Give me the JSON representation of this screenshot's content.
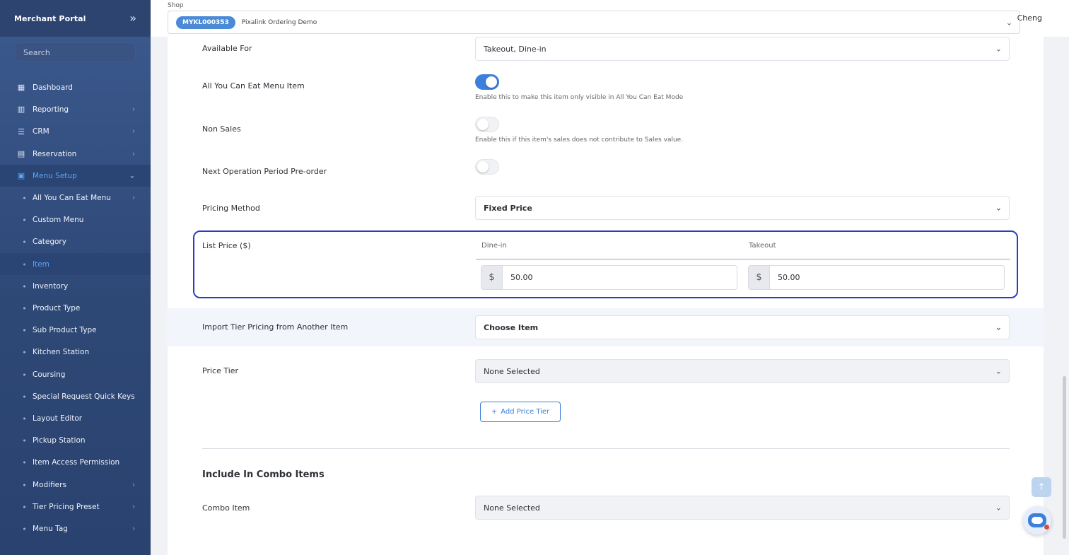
{
  "sidebar": {
    "brand": "Merchant Portal",
    "search_placeholder": "Search",
    "items": [
      {
        "label": "Dashboard"
      },
      {
        "label": "Reporting"
      },
      {
        "label": "CRM"
      },
      {
        "label": "Reservation"
      },
      {
        "label": "Menu Setup"
      }
    ],
    "sub_items": [
      {
        "label": "All You Can Eat Menu"
      },
      {
        "label": "Custom Menu"
      },
      {
        "label": "Category"
      },
      {
        "label": "Item"
      },
      {
        "label": "Inventory"
      },
      {
        "label": "Product Type"
      },
      {
        "label": "Sub Product Type"
      },
      {
        "label": "Kitchen Station"
      },
      {
        "label": "Coursing"
      },
      {
        "label": "Special Request Quick Keys"
      },
      {
        "label": "Layout Editor"
      },
      {
        "label": "Pickup Station"
      },
      {
        "label": "Item Access Permission"
      },
      {
        "label": "Modifiers"
      },
      {
        "label": "Tier Pricing Preset"
      },
      {
        "label": "Menu Tag"
      }
    ]
  },
  "header": {
    "shop_label": "Shop",
    "shop_code": "MYKL000353",
    "shop_name": "Pixalink Ordering Demo",
    "user": "Cheng"
  },
  "form": {
    "available_for": {
      "label": "Available For",
      "value": "Takeout, Dine-in"
    },
    "ayce": {
      "label": "All You Can Eat Menu Item",
      "help": "Enable this to make this item only visible in All You Can Eat Mode",
      "enabled": true
    },
    "non_sales": {
      "label": "Non Sales",
      "help": "Enable this if this item's sales does not contribute to Sales value.",
      "enabled": false
    },
    "next_period": {
      "label": "Next Operation Period Pre-order",
      "enabled": false
    },
    "pricing_method": {
      "label": "Pricing Method",
      "value": "Fixed Price"
    },
    "list_price": {
      "label": "List Price ($)",
      "dine_in_label": "Dine-in",
      "takeout_label": "Takeout",
      "currency": "$",
      "dine_in_value": "50.00",
      "takeout_value": "50.00"
    },
    "import_tier": {
      "label": "Import Tier Pricing from Another Item",
      "value": "Choose Item"
    },
    "price_tier": {
      "label": "Price Tier",
      "value": "None Selected",
      "add_button": "Add Price Tier"
    },
    "combo_section": {
      "title": "Include In Combo Items",
      "label": "Combo Item",
      "value": "None Selected"
    }
  },
  "colors": {
    "accent": "#3d7fdc",
    "highlight_border": "#2a3fbf",
    "sidebar": "#2e4876"
  }
}
